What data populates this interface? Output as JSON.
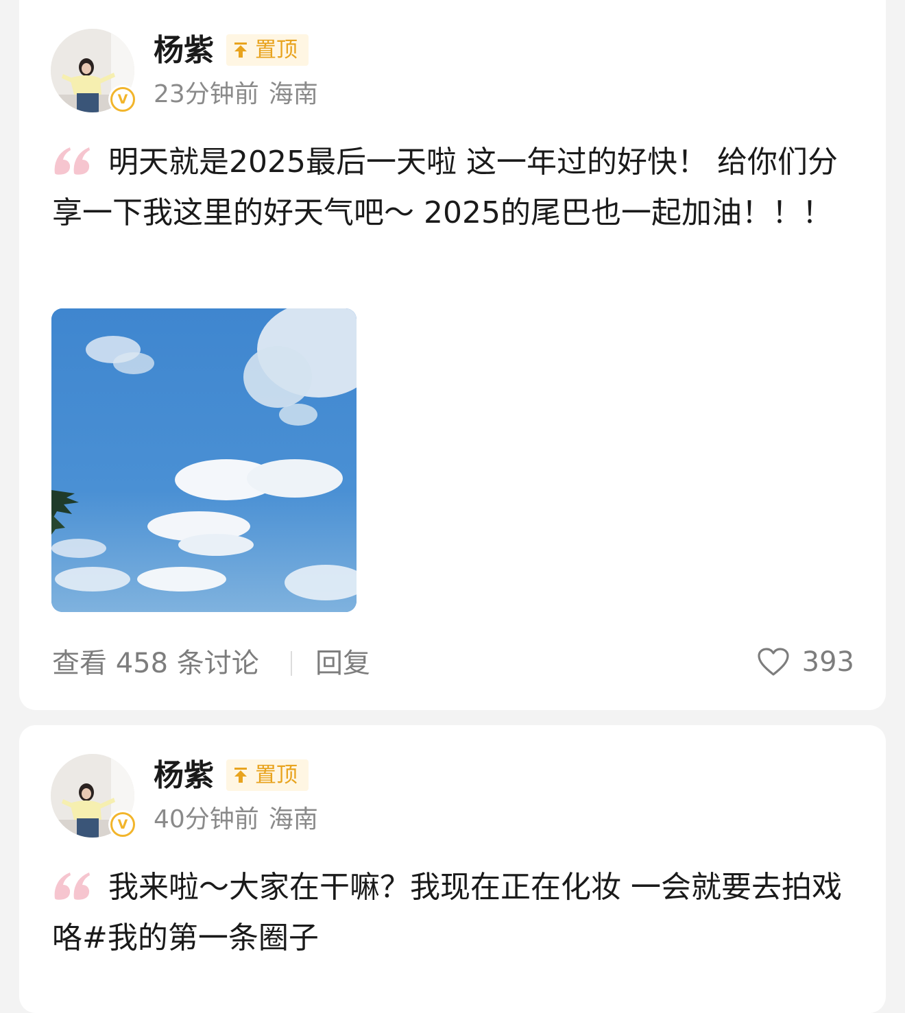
{
  "posts": [
    {
      "author": "杨紫",
      "pin_label": "置顶",
      "verified_badge": "V",
      "time": "23分钟前",
      "location": "海南",
      "text": "明天就是2025最后一天啦 这一年过的好快！ 给你们分享一下我这里的好天气吧～ 2025的尾巴也一起加油！！！",
      "image": "sky-photo",
      "view_discussions": "查看 458 条讨论",
      "reply_label": "回复",
      "like_count": "393"
    },
    {
      "author": "杨紫",
      "pin_label": "置顶",
      "verified_badge": "V",
      "time": "40分钟前",
      "location": "海南",
      "text": "我来啦～大家在干嘛？我现在正在化妆 一会就要去拍戏咯#我的第一条圈子"
    }
  ],
  "icons": {
    "pin": "pin-up-arrow-icon",
    "quote": "quote-icon",
    "like": "heart-icon",
    "verified": "verified-v-icon"
  },
  "colors": {
    "background": "#f3f3f3",
    "card": "#ffffff",
    "pin_text": "#e8a31e",
    "pin_bg": "#fff6e3",
    "verified": "#f2b52b",
    "quote": "#f6c5cf",
    "meta_text": "#8a8a8a"
  }
}
